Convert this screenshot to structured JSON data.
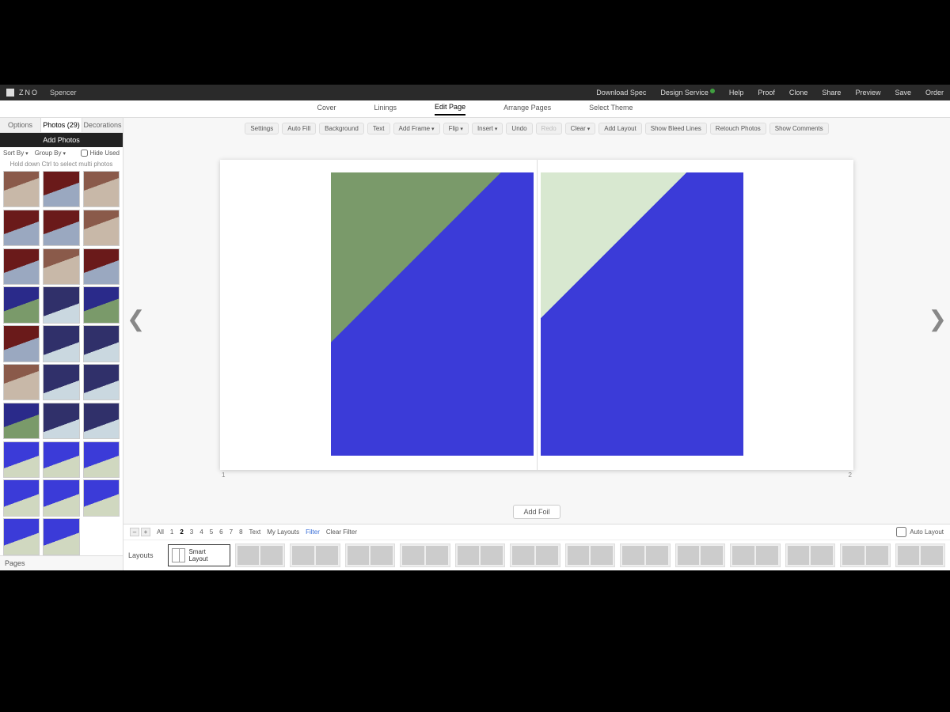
{
  "topbar": {
    "brand": "ZNO",
    "project": "Spencer",
    "nav": {
      "download_spec": "Download Spec",
      "design_service": "Design Service",
      "help": "Help",
      "proof": "Proof",
      "clone": "Clone",
      "share": "Share",
      "preview": "Preview",
      "save": "Save",
      "order": "Order"
    }
  },
  "subnav": {
    "cover": "Cover",
    "linings": "Linings",
    "edit_page": "Edit Page",
    "arrange_pages": "Arrange Pages",
    "select_theme": "Select Theme"
  },
  "sidebar": {
    "tabs": {
      "options": "Options",
      "photos": "Photos (29)",
      "decorations": "Decorations"
    },
    "add_photos": "Add Photos",
    "sort_by": "Sort By",
    "group_by": "Group By",
    "hide_used": "Hide Used",
    "hint": "Hold down Ctrl to select multi photos",
    "pages_label": "Pages"
  },
  "toolbar": {
    "settings": "Settings",
    "auto_fill": "Auto Fill",
    "background": "Background",
    "text": "Text",
    "add_frame": "Add Frame",
    "flip": "Flip",
    "insert": "Insert",
    "undo": "Undo",
    "redo": "Redo",
    "clear": "Clear",
    "add_layout": "Add Layout",
    "show_bleed": "Show Bleed Lines",
    "retouch": "Retouch Photos",
    "show_comments": "Show Comments"
  },
  "spread": {
    "left_page_num": "1",
    "right_page_num": "2",
    "add_foil": "Add Foil"
  },
  "filterbar": {
    "all": "All",
    "nums": [
      "1",
      "2",
      "3",
      "4",
      "5",
      "6",
      "7",
      "8"
    ],
    "active_num": "2",
    "text": "Text",
    "my_layouts": "My Layouts",
    "filter": "Filter",
    "clear_filter": "Clear Filter",
    "auto_layout": "Auto Layout"
  },
  "layouts": {
    "label": "Layouts",
    "smart_layout": "Smart Layout"
  }
}
